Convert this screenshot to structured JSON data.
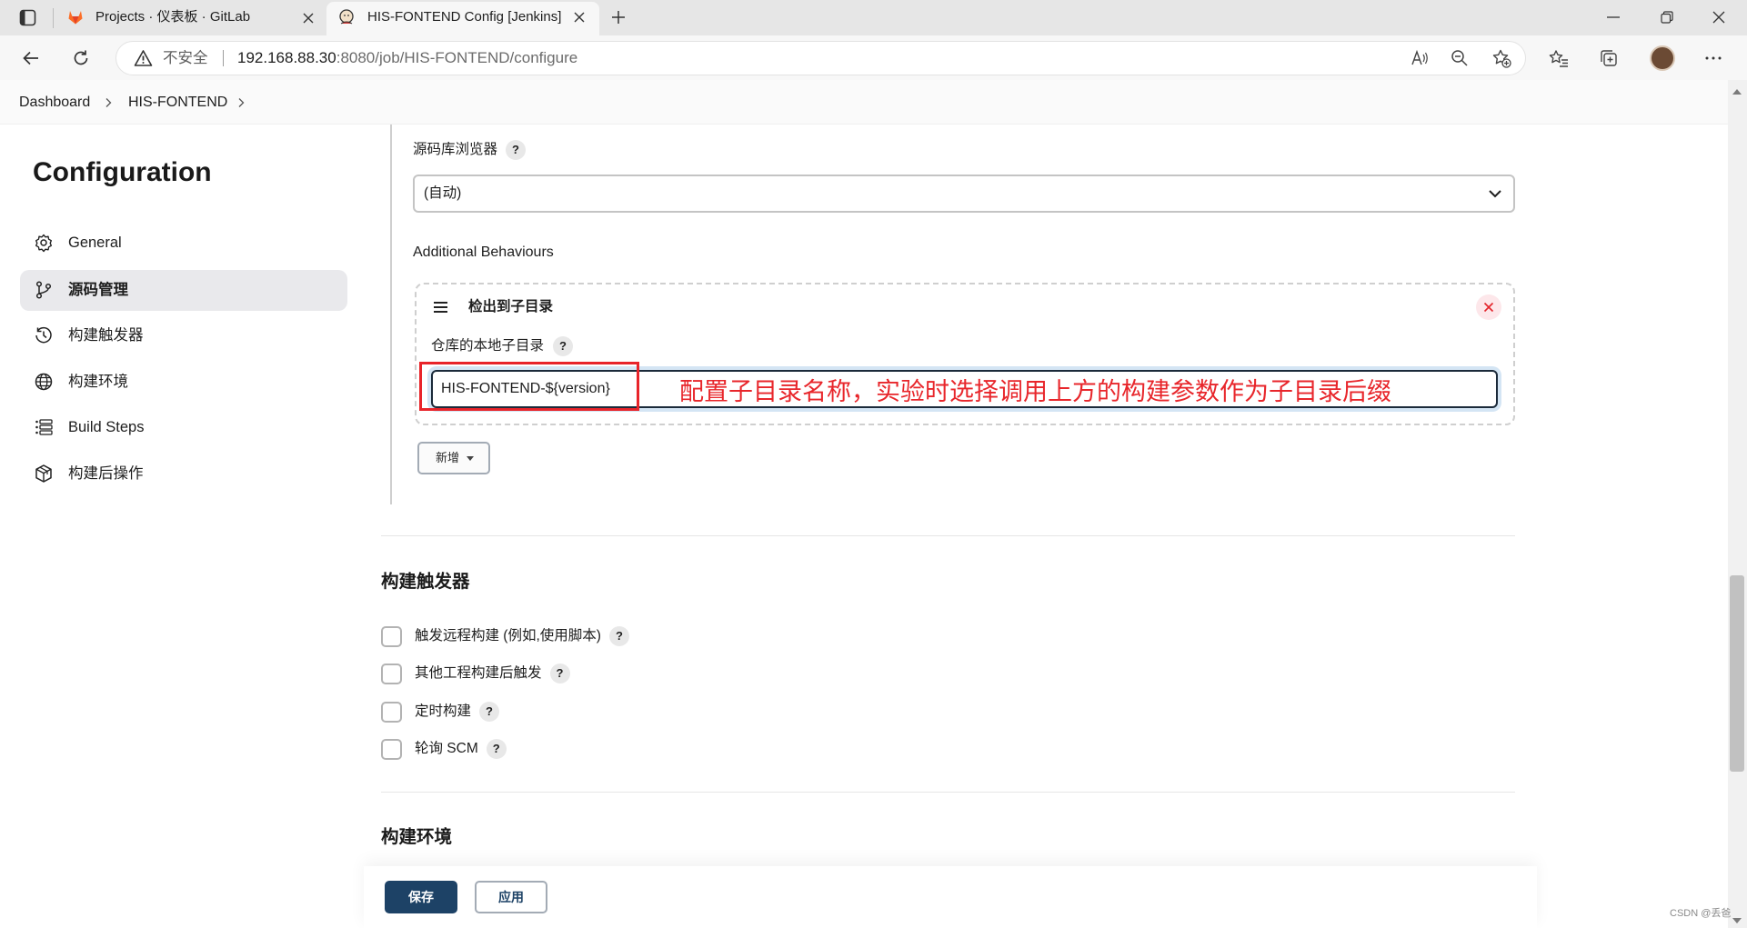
{
  "browser": {
    "tabs": [
      {
        "title": "Projects · 仪表板 · GitLab",
        "icon": "gitlab-icon",
        "active": false
      },
      {
        "title": "HIS-FONTEND Config [Jenkins]",
        "icon": "jenkins-icon",
        "active": true
      }
    ],
    "address": {
      "security_label": "不安全",
      "host": "192.168.88.30",
      "path": ":8080/job/HIS-FONTEND/configure"
    }
  },
  "breadcrumb": [
    {
      "label": "Dashboard"
    },
    {
      "label": "HIS-FONTEND"
    }
  ],
  "sidebar": {
    "title": "Configuration",
    "items": [
      {
        "label": "General",
        "icon": "gear-icon",
        "active": false
      },
      {
        "label": "源码管理",
        "icon": "git-branch-icon",
        "active": true
      },
      {
        "label": "构建触发器",
        "icon": "clock-icon",
        "active": false
      },
      {
        "label": "构建环境",
        "icon": "globe-icon",
        "active": false
      },
      {
        "label": "Build Steps",
        "icon": "list-icon",
        "active": false
      },
      {
        "label": "构建后操作",
        "icon": "cube-icon",
        "active": false
      }
    ]
  },
  "help_mark": "?",
  "scm": {
    "browser_label": "源码库浏览器",
    "browser_value": "(自动)",
    "additional_behaviours_label": "Additional Behaviours",
    "behaviour": {
      "title": "检出到子目录",
      "field_label": "仓库的本地子目录",
      "field_value": "HIS-FONTEND-${version}"
    },
    "add_button_label": "新增"
  },
  "annotation": {
    "text": "配置子目录名称，实验时选择调用上方的构建参数作为子目录后缀",
    "color": "#e8262b"
  },
  "triggers": {
    "heading": "构建触发器",
    "options": [
      {
        "label": "触发远程构建 (例如,使用脚本)",
        "checked": false
      },
      {
        "label": "其他工程构建后触发",
        "checked": false
      },
      {
        "label": "定时构建",
        "checked": false
      },
      {
        "label": "轮询 SCM",
        "checked": false
      }
    ]
  },
  "env": {
    "heading": "构建环境"
  },
  "footer": {
    "save": "保存",
    "apply": "应用"
  },
  "watermark": "CSDN @丢爸",
  "colors": {
    "primary_button": "#1d4266",
    "annotation_red": "#e8262b",
    "active_sidebar_bg": "#e9e9ec",
    "close_button_bg": "#fde7ea"
  }
}
